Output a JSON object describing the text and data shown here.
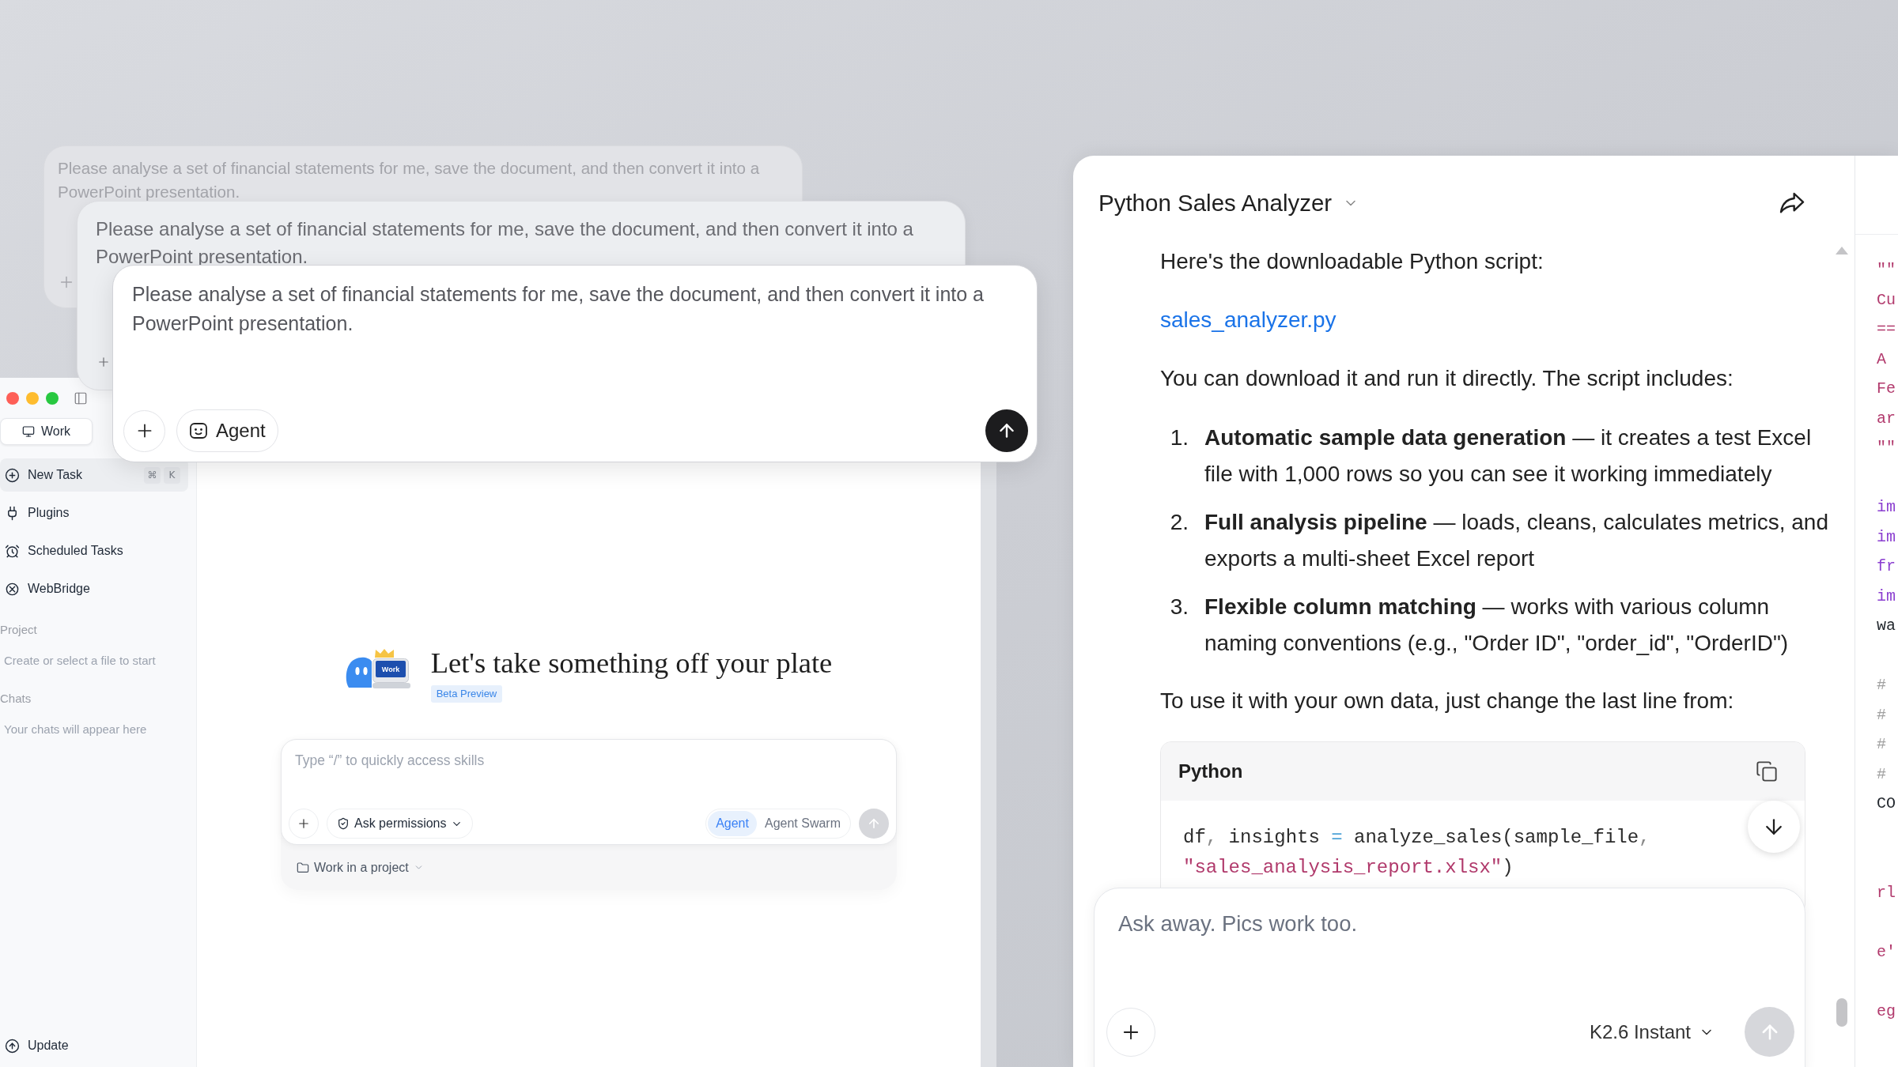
{
  "prompt_cards": [
    {
      "kind": "faded",
      "value": "Please analyse a set of financial statements for me, save the document, and then convert it into a PowerPoint presentation."
    },
    {
      "kind": "dimmed",
      "value": "Please analyse a set of financial statements for me, save the document, and then convert it into a PowerPoint presentation."
    },
    {
      "kind": "front",
      "value": "Please analyse a set of financial statements for me, save the document, and then convert it into a PowerPoint presentation.",
      "mode_button": "Agent",
      "send_disabled": false
    }
  ],
  "app_window": {
    "tabs": [
      {
        "label": "Work",
        "selected": true
      }
    ],
    "sidebar": {
      "items": [
        {
          "label": "New Task",
          "selected": true,
          "shortcut": [
            "⌘",
            "K"
          ]
        },
        {
          "label": "Plugins",
          "selected": false
        },
        {
          "label": "Scheduled Tasks",
          "selected": false
        },
        {
          "label": "WebBridge",
          "selected": false
        }
      ],
      "sections": [
        {
          "heading": "Project",
          "empty_text": "Create or select a file to start"
        },
        {
          "heading": "Chats",
          "empty_text": "Your chats will appear here"
        }
      ],
      "footer_item": "Update"
    },
    "welcome": {
      "mascot_screen_text": "Work",
      "heading": "Let's take something off your plate",
      "badge": "Beta Preview"
    },
    "composer": {
      "placeholder": "Type “/” to quickly access skills",
      "permission_button": "Ask permissions",
      "modes": [
        {
          "label": "Agent",
          "selected": true
        },
        {
          "label": "Agent Swarm",
          "selected": false
        }
      ],
      "send_disabled": true,
      "project_button": "Work in a project"
    }
  },
  "chat_panel": {
    "title": "Python Sales Analyzer",
    "message": {
      "intro": "Here's the downloadable Python script:",
      "link": "sales_analyzer.py",
      "lead": "You can download it and run it directly. The script includes:",
      "list": [
        {
          "number": "1.",
          "text": "**Automatic sample data generation** — it creates a test Excel file with 1,000 rows so you can see it working immediately"
        },
        {
          "number": "2.",
          "text": "**Full analysis pipeline** — loads, cleans, calculates metrics, and exports a multi-sheet Excel report"
        },
        {
          "number": "3.",
          "text": "**Flexible column matching** — works with various column naming conventions (e.g., \"Order ID\", \"order_id\", \"OrderID\")"
        }
      ],
      "outro": "To use it with your own data, just change the last line from:",
      "code_block": {
        "language": "Python",
        "lines": [
          {
            "tokens": [
              {
                "kind": "plain",
                "text": "df"
              },
              {
                "kind": "punct",
                "text": ","
              },
              {
                "kind": "plain",
                "text": " insights "
              },
              {
                "kind": "operator",
                "text": "="
              },
              {
                "kind": "plain",
                "text": " analyze_sales(sample_file"
              },
              {
                "kind": "punct",
                "text": ","
              }
            ]
          },
          {
            "tokens": [
              {
                "kind": "string",
                "text": "\"sales_analysis_report.xlsx\""
              },
              {
                "kind": "plain",
                "text": ")"
              }
            ]
          }
        ]
      }
    },
    "input": {
      "placeholder": "Ask away. Pics work too.",
      "model": "K2.6 Instant",
      "send_disabled": true
    }
  },
  "code_panel": {
    "lines": [
      {
        "kind": "string",
        "text": "\"\""
      },
      {
        "kind": "string",
        "text": "Cu"
      },
      {
        "kind": "string",
        "text": "=="
      },
      {
        "kind": "string",
        "text": "A"
      },
      {
        "kind": "string",
        "text": "Fe"
      },
      {
        "kind": "string",
        "text": "ar"
      },
      {
        "kind": "string",
        "text": "\"\""
      },
      {
        "kind": "blank"
      },
      {
        "kind": "keyword",
        "text": "im"
      },
      {
        "kind": "keyword",
        "text": "im"
      },
      {
        "kind": "keyword",
        "text": "fr"
      },
      {
        "kind": "keyword",
        "text": "im"
      },
      {
        "kind": "plain",
        "text": "wa"
      },
      {
        "kind": "blank"
      },
      {
        "kind": "comment",
        "text": "#"
      },
      {
        "kind": "comment",
        "text": "#"
      },
      {
        "kind": "comment",
        "text": "#"
      },
      {
        "kind": "comment",
        "text": "#"
      },
      {
        "kind": "plain",
        "text": "CO"
      },
      {
        "kind": "blank"
      },
      {
        "kind": "blank"
      },
      {
        "kind": "string",
        "text": "rl"
      },
      {
        "kind": "blank"
      },
      {
        "kind": "string",
        "text": "e'"
      },
      {
        "kind": "blank"
      },
      {
        "kind": "string",
        "text": "eg"
      }
    ]
  }
}
